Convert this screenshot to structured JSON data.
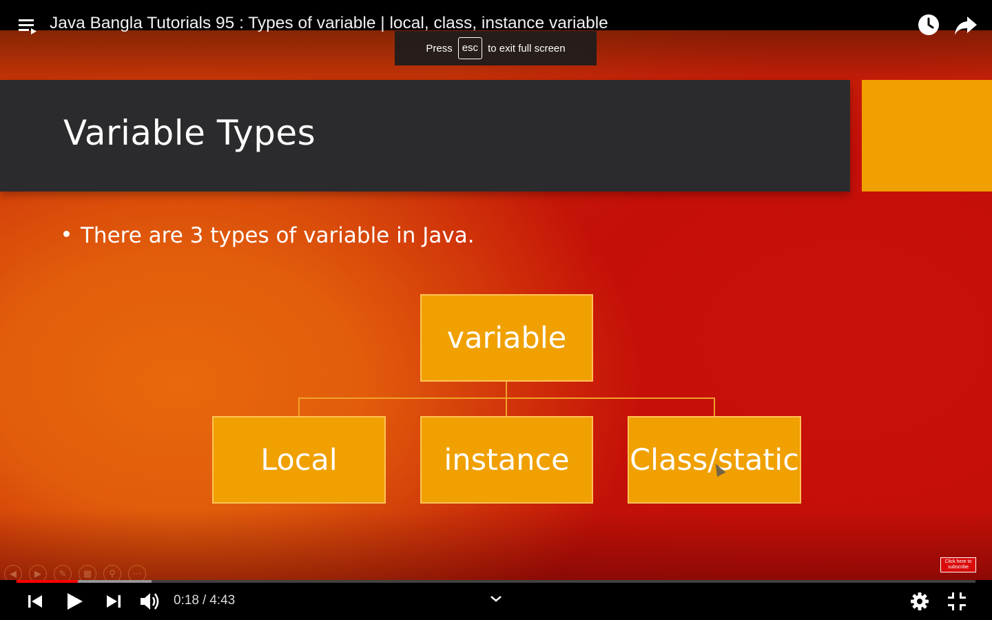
{
  "header": {
    "video_title": "Java Bangla Tutorials 95 : Types of variable | local, class, instance variable",
    "menu_icon": "playlist-menu-icon",
    "watch_later_icon": "clock-icon",
    "share_icon": "share-arrow-icon"
  },
  "fullscreen_toast": {
    "press": "Press",
    "key": "esc",
    "suffix": "to exit full screen"
  },
  "slide": {
    "title": "Variable Types",
    "bullet": "There are 3 types of variable in Java.",
    "root_box": "variable",
    "child_boxes": [
      "Local",
      "instance",
      "Class/static"
    ],
    "subscribe_badge": "Click here to subscribe",
    "colors": {
      "title_band": "#2b2a2c",
      "box_fill": "#f0a000",
      "background_top": "#f08a08",
      "background_bottom": "#b01008"
    }
  },
  "controls": {
    "current_time": "0:18",
    "separator": "/",
    "duration": "4:43",
    "progress_played_fraction": 0.064,
    "progress_buffered_fraction": 0.141,
    "progress_color": "#ff0000",
    "icons": [
      "previous-icon",
      "play-icon",
      "next-icon",
      "volume-icon",
      "chevron-down-icon",
      "settings-gear-icon",
      "exit-fullscreen-icon"
    ]
  }
}
